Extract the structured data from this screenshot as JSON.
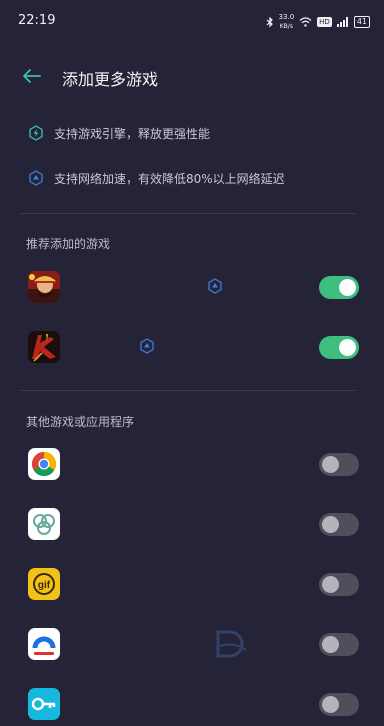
{
  "status_bar": {
    "time": "22:19",
    "net_speed": "33.0",
    "net_unit": "KB/s",
    "battery": "41",
    "hd": "HD"
  },
  "header": {
    "title": "添加更多游戏"
  },
  "features": [
    {
      "icon": "engine-shield-icon",
      "text": "支持游戏引擎，释放更强性能"
    },
    {
      "icon": "network-boost-icon",
      "text": "支持网络加速，有效降低80%以上网络延迟"
    }
  ],
  "sections": {
    "recommended": "推荐添加的游戏",
    "others": "其他游戏或应用程序"
  },
  "recommended_apps": [
    {
      "icon": "one-piece-game-icon",
      "enabled": true,
      "network_boost": true
    },
    {
      "icon": "martial-arts-game-icon",
      "enabled": true,
      "network_boost": true
    }
  ],
  "other_apps": [
    {
      "icon": "chrome-icon",
      "enabled": false
    },
    {
      "icon": "knot-app-icon",
      "enabled": false
    },
    {
      "icon": "gif-app-icon",
      "enabled": false
    },
    {
      "icon": "blue-arc-app-icon",
      "enabled": false
    },
    {
      "icon": "key-app-icon",
      "enabled": false
    }
  ],
  "colors": {
    "background": "#242337",
    "toggle_on": "#3fbf7f",
    "toggle_off": "#5a5a66",
    "accent": "#3f7fd9",
    "engine_accent": "#3fbfb0"
  }
}
